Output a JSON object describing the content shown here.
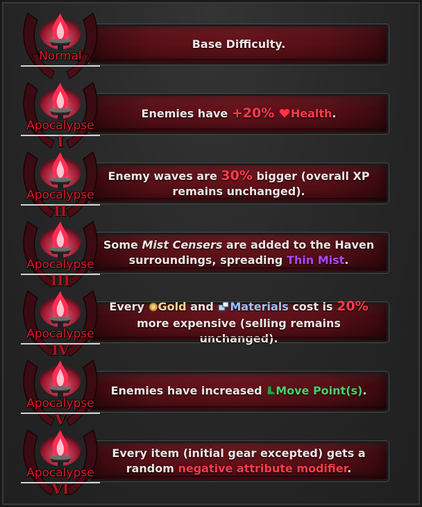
{
  "colors": {
    "accent_red": "#ff3b4a",
    "tier_red": "#e0182a",
    "mist_purple": "#b143ff",
    "move_green": "#4ad06b",
    "banner_red": "#6a141c"
  },
  "tiers": [
    {
      "label": "Normal",
      "roman": "",
      "desc": {
        "text": "Base Difficulty."
      }
    },
    {
      "label": "Apocalypse",
      "roman": "I",
      "desc": {
        "pre": "Enemies have ",
        "value": "+20%",
        "icon": "heart-icon",
        "stat": "Health",
        "post": "."
      }
    },
    {
      "label": "Apocalypse",
      "roman": "II",
      "desc": {
        "pre": "Enemy waves are ",
        "value": "30%",
        "post_line1": " bigger (overall XP",
        "line2": "remains unchanged)."
      }
    },
    {
      "label": "Apocalypse",
      "roman": "III",
      "desc": {
        "pre": "Some ",
        "italic": "Mist Censers",
        "mid": " are added to the Haven",
        "line2_pre": "surroundings, spreading ",
        "mist": "Thin Mist",
        "post": "."
      }
    },
    {
      "label": "Apocalypse",
      "roman": "IV",
      "desc": {
        "pre": "Every ",
        "gold_icon": "gold-coin-icon",
        "gold": "Gold",
        "and": " and ",
        "mat_icon": "materials-icon",
        "materials": "Materials",
        "cost": " cost is ",
        "value": "20%",
        "line2": "more expensive (selling remains unchanged)."
      }
    },
    {
      "label": "Apocalypse",
      "roman": "V",
      "desc": {
        "pre": "Enemies have increased ",
        "icon": "move-boot-icon",
        "stat": "Move Point(s)",
        "post": "."
      }
    },
    {
      "label": "Apocalypse",
      "roman": "VI",
      "desc": {
        "line1": "Every item (initial gear excepted) gets a",
        "line2_pre": "random ",
        "neg": "negative attribute modifier",
        "post": "."
      }
    }
  ]
}
